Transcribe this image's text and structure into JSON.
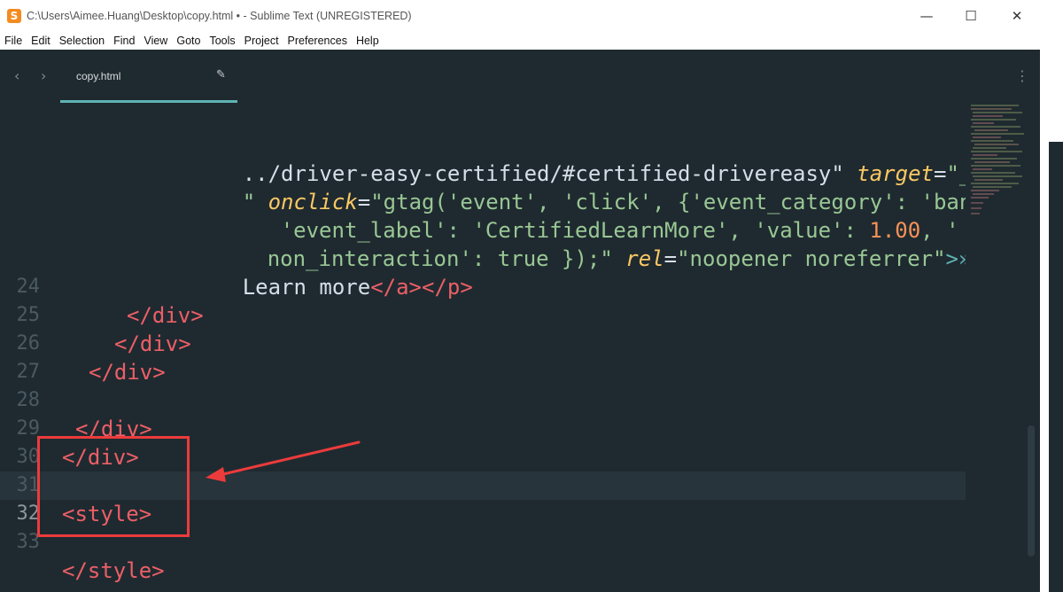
{
  "window": {
    "title": "C:\\Users\\Aimee.Huang\\Desktop\\copy.html • - Sublime Text (UNREGISTERED)",
    "app_icon_glyph": "S",
    "controls": {
      "minimize": "—",
      "maximize": "☐",
      "close": "✕"
    }
  },
  "menu": [
    "File",
    "Edit",
    "Selection",
    "Find",
    "View",
    "Goto",
    "Tools",
    "Project",
    "Preferences",
    "Help"
  ],
  "tabbar": {
    "back": "‹",
    "forward": "›",
    "tab_label": "copy.html",
    "edit_icon": "✎",
    "more_icon": "⋮"
  },
  "editor": {
    "line_numbers": [
      "24",
      "25",
      "26",
      "27",
      "28",
      "29",
      "30",
      "31",
      "32",
      "33"
    ],
    "current_line": "32",
    "wrapped": {
      "l1_path": "../driver-easy-certified/#certified-drivereasy\"",
      "l1_attr": "target",
      "l1_eq": "=",
      "l1_val": "\"_blank",
      "l2_quote": "\"",
      "l2_attr": "onclick",
      "l2_eq": "=",
      "l2_val": "\"gtag('event', 'click', {'event_category': 'banner',",
      "l3_val": "'event_label': 'CertifiedLearnMore', 'value': ",
      "l3_num": "1.00",
      "l3_tail": ", '",
      "l4_val": "non_interaction': true });\"",
      "l4_attr": "rel",
      "l4_eq": "=",
      "l4_str": "\"noopener noreferrer\"",
      "l4_close": ">»",
      "l5_text": "Learn more",
      "l5_tags": "</a></p>"
    },
    "lines": {
      "l24": "</div>",
      "l25": "</div>",
      "l26": "</div>",
      "l28": "</div>",
      "l29": "</div>",
      "l31": "<style>",
      "l33": "</style>"
    }
  },
  "colors": {
    "background": "#1f2a30",
    "tag": "#ec5f67",
    "punct": "#5fb3b3",
    "attribute": "#fac863",
    "string": "#99c794",
    "number": "#f99157",
    "annotation": "#ec3b3b"
  }
}
